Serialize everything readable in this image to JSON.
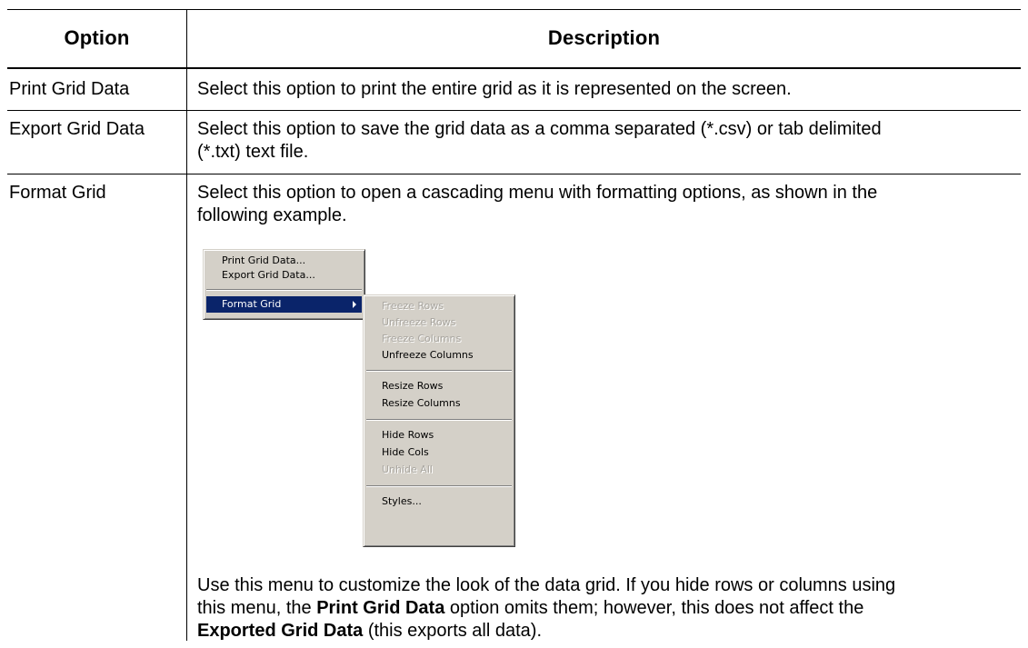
{
  "table": {
    "headers": {
      "option": "Option",
      "description": "Description"
    },
    "rows": [
      {
        "option": "Print Grid Data",
        "description": "Select this option to print the entire grid as it is represented on the screen."
      },
      {
        "option": "Export Grid Data",
        "description_line1": "Select this option to save the grid data as a comma separated (*.csv) or tab delimited",
        "description_line2": "(*.txt) text file."
      },
      {
        "option": "Format Grid",
        "intro_line1": "Select this option to open a cascading menu with formatting options, as shown in the",
        "intro_line2": "following example.",
        "after_line1": "Use this menu to customize the look of the data grid. If you hide rows or columns using",
        "after_line2_a": "this menu, the ",
        "after_line2_bold": "Print Grid Data",
        "after_line2_b": " option omits them; however, this does not affect the",
        "after_line3_bold": "Exported Grid Data",
        "after_line3_b": " (this exports all data)."
      }
    ]
  },
  "context_menu": {
    "items": [
      {
        "label": "Print Grid Data...",
        "state": "enabled"
      },
      {
        "label": "Export Grid Data...",
        "state": "enabled"
      },
      {
        "label": "Format Grid",
        "state": "selected",
        "submenu": true
      }
    ]
  },
  "submenu": {
    "items": [
      {
        "label": "Freeze Rows",
        "state": "disabled"
      },
      {
        "label": "Unfreeze Rows",
        "state": "disabled"
      },
      {
        "label": "Freeze Columns",
        "state": "disabled"
      },
      {
        "label": "Unfreeze Columns",
        "state": "enabled"
      },
      {
        "label": "Resize Rows",
        "state": "enabled"
      },
      {
        "label": "Resize Columns",
        "state": "enabled"
      },
      {
        "label": "Hide Rows",
        "state": "enabled"
      },
      {
        "label": "Hide Cols",
        "state": "enabled"
      },
      {
        "label": "Unhide All",
        "state": "disabled"
      },
      {
        "label": "Styles...",
        "state": "enabled"
      }
    ]
  },
  "colors": {
    "menu_face": "#d4d0c8",
    "menu_highlight": "#0a246a",
    "disabled_text": "#a9a6a0"
  }
}
